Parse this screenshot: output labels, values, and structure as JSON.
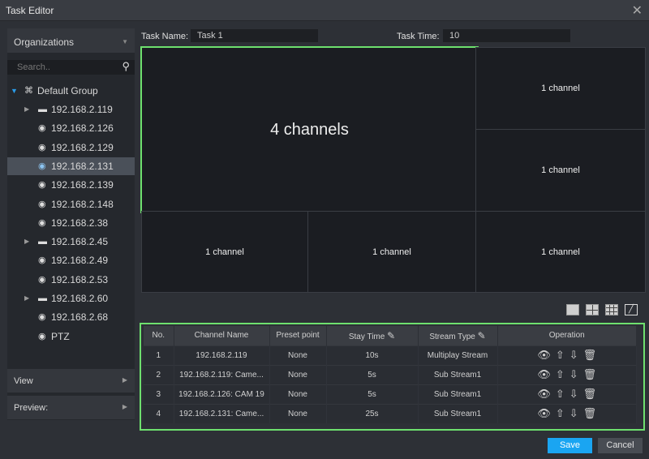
{
  "window": {
    "title": "Task Editor"
  },
  "sidebar": {
    "dropdown": "Organizations",
    "search_placeholder": "Search..",
    "root": "Default Group",
    "items": [
      {
        "label": "192.168.2.119",
        "type": "nvr",
        "expandable": true
      },
      {
        "label": "192.168.2.126",
        "type": "camera"
      },
      {
        "label": "192.168.2.129",
        "type": "camera"
      },
      {
        "label": "192.168.2.131",
        "type": "camera",
        "selected": true
      },
      {
        "label": "192.168.2.139",
        "type": "camera"
      },
      {
        "label": "192.168.2.148",
        "type": "camera"
      },
      {
        "label": "192.168.2.38",
        "type": "camera"
      },
      {
        "label": "192.168.2.45",
        "type": "nvr",
        "expandable": true
      },
      {
        "label": "192.168.2.49",
        "type": "camera"
      },
      {
        "label": "192.168.2.53",
        "type": "camera"
      },
      {
        "label": "192.168.2.60",
        "type": "nvr",
        "expandable": true
      },
      {
        "label": "192.168.2.68",
        "type": "camera"
      },
      {
        "label": "PTZ",
        "type": "camera"
      }
    ],
    "view": "View",
    "preview": "Preview:"
  },
  "task": {
    "name_label": "Task Name:",
    "name": "Task 1",
    "time_label": "Task Time:",
    "time": "10"
  },
  "grid": {
    "big": "4 channels",
    "cells": [
      "1 channel",
      "1 channel",
      "1 channel",
      "1 channel",
      "1 channel"
    ]
  },
  "table": {
    "headers": [
      "No.",
      "Channel Name",
      "Preset point",
      "Stay Time",
      "Stream Type",
      "Operation"
    ],
    "rows": [
      [
        "1",
        "192.168.2.119",
        "None",
        "10s",
        "Multiplay Stream"
      ],
      [
        "2",
        "192.168.2.119: Came...",
        "None",
        "5s",
        "Sub Stream1"
      ],
      [
        "3",
        "192.168.2.126: CAM 19",
        "None",
        "5s",
        "Sub Stream1"
      ],
      [
        "4",
        "192.168.2.131: Came...",
        "None",
        "25s",
        "Sub Stream1"
      ]
    ]
  },
  "buttons": {
    "save": "Save",
    "cancel": "Cancel"
  },
  "colors": {
    "accent": "#1aa5f2",
    "highlight": "#6ee06e"
  }
}
